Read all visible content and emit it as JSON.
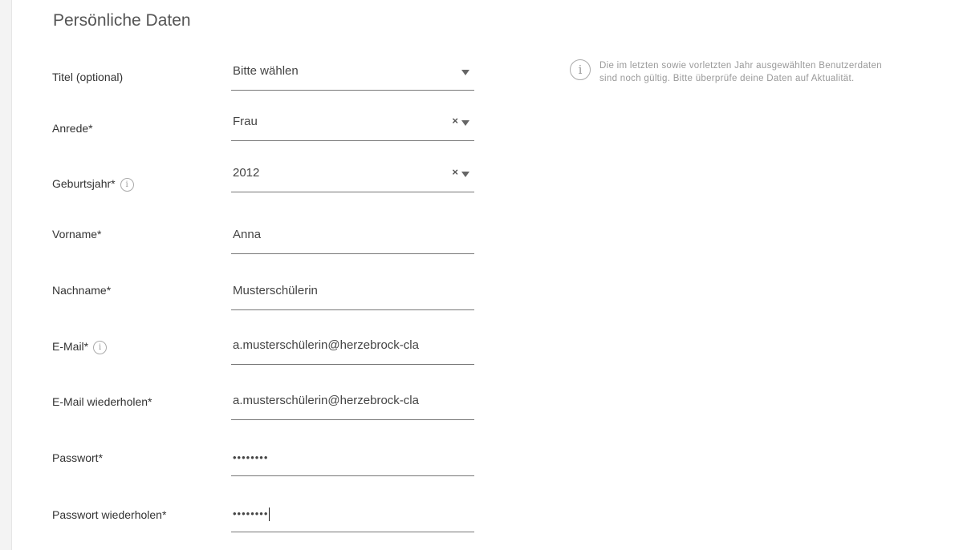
{
  "section": {
    "title": "Persönliche Daten"
  },
  "notice": {
    "icon": "info-icon",
    "text": "Die im letzten sowie vorletzten Jahr ausgewählten Benutzerdaten sind noch gültig. Bitte überprüfe deine Daten auf Aktualität."
  },
  "fields": {
    "titel": {
      "label": "Titel (optional)",
      "value": "Bitte wählen"
    },
    "anrede": {
      "label": "Anrede*",
      "value": "Frau",
      "clear": "×"
    },
    "geburtsjahr": {
      "label": "Geburtsjahr*",
      "value": "2012",
      "clear": "×"
    },
    "vorname": {
      "label": "Vorname*",
      "value": "Anna"
    },
    "nachname": {
      "label": "Nachname*",
      "value": "Musterschülerin"
    },
    "email": {
      "label": "E-Mail*",
      "value": "a.musterschülerin@herzebrock-cla"
    },
    "email_repeat": {
      "label": "E-Mail wiederholen*",
      "value": "a.musterschülerin@herzebrock-cla"
    },
    "passwort": {
      "label": "Passwort*",
      "value": "••••••••"
    },
    "passwort_repeat": {
      "label": "Passwort wiederholen*",
      "value": "••••••••"
    }
  }
}
